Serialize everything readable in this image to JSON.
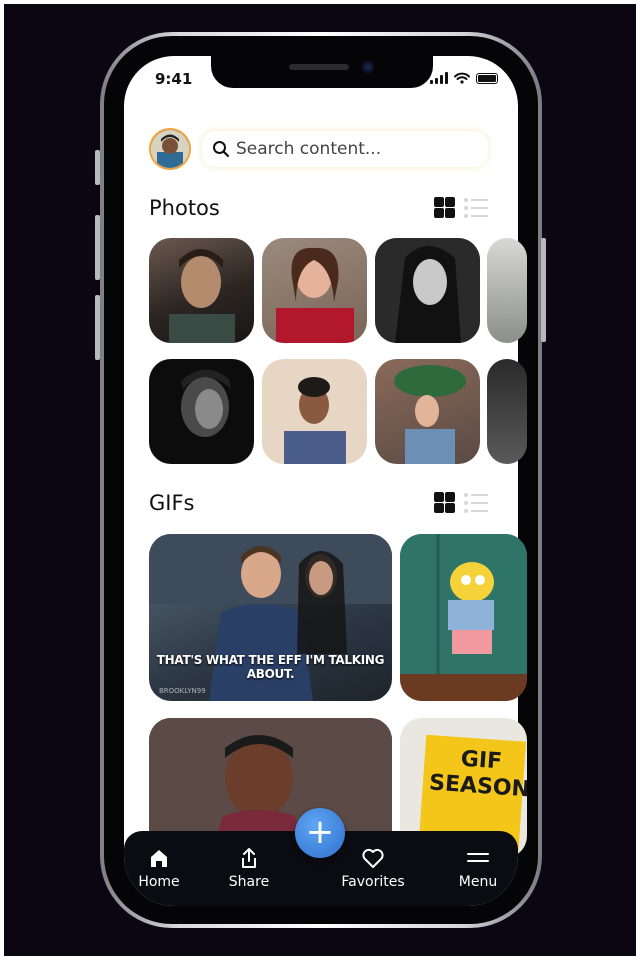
{
  "status_bar": {
    "time": "9:41"
  },
  "search": {
    "placeholder": "Search content..."
  },
  "photos": {
    "title": "Photos"
  },
  "gifs": {
    "title": "GIFs",
    "caption": "THAT'S WHAT THE EFF I'M TALKING ABOUT.",
    "watermark": "BROOKLYN99",
    "season_text": "GIF SEASON"
  },
  "tab_bar": {
    "home": "Home",
    "share": "Share",
    "favorites": "Favorites",
    "menu": "Menu",
    "add_label": "+"
  },
  "colors": {
    "background": "#0c0613",
    "accent_blue": "#3b82d6",
    "avatar_ring": "#f2a23a",
    "tab_bar": "#0b0b12"
  },
  "icons": [
    "search-icon",
    "grid-view-icon",
    "list-view-icon",
    "home-icon",
    "share-icon",
    "heart-icon",
    "menu-icon",
    "plus-icon"
  ]
}
